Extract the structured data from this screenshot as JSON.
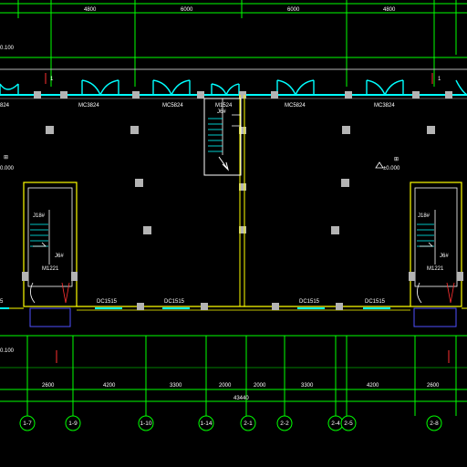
{
  "top_dims": [
    "4800",
    "6000",
    "6000",
    "4800"
  ],
  "elevations": {
    "top_left": "0.100",
    "bottom_left": "0.100",
    "floor_left": "0.000",
    "floor_right": "±0.000"
  },
  "section_marks": [
    "1",
    "1"
  ],
  "door_labels": [
    "MC3824",
    "MC5824",
    "M1524",
    "MC5824",
    "MC3824"
  ],
  "door_labels_sub": [
    "J6#"
  ],
  "stair_labels": [
    "J18#",
    "J18#"
  ],
  "stair_sub_labels": [
    "J6#",
    "J6#"
  ],
  "inner_door_labels": [
    "M1221",
    "M1221"
  ],
  "window_labels": [
    "DC1515",
    "DC1515",
    "DC1515",
    "DC1515"
  ],
  "edge_labels": [
    "824",
    "5"
  ],
  "bottom_dims": [
    "2600",
    "4200",
    "3300",
    "2000",
    "2000",
    "3300",
    "4200",
    "2600"
  ],
  "total_dim": "43440",
  "axes": [
    "1-7",
    "1-9",
    "1-10",
    "1-14",
    "2-1",
    "2-2",
    "2-4",
    "2-5",
    "2-8"
  ],
  "colors": {
    "wall": "#ffff00",
    "dim": "#00ff00",
    "glass": "#00ffff",
    "column": "#b4b4b4",
    "axis": "#00ff00",
    "text": "#ffffff"
  }
}
